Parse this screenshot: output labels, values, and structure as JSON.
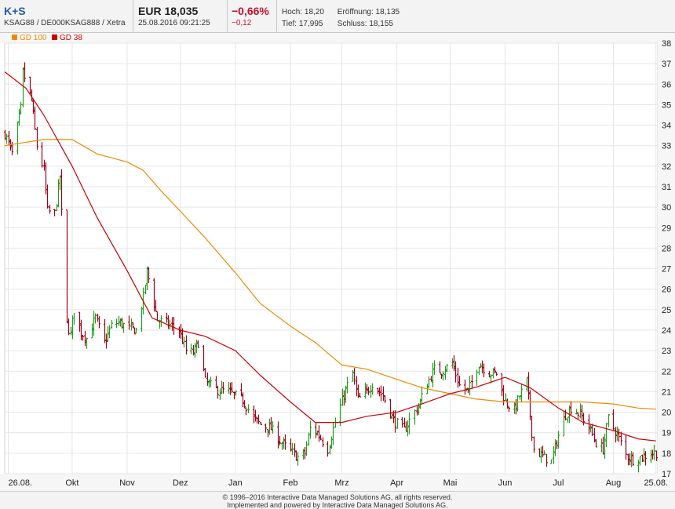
{
  "header": {
    "symbol": "K+S",
    "identifier": "KSAG88 / DE000KSAG888 / Xetra",
    "price": "EUR 18,035",
    "datetime": "25.08.2016 09:21:25",
    "change_pct": "−0,66%",
    "change_abs": "−0,12",
    "high_label": "Hoch:",
    "high_value": "18,20",
    "open_label": "Eröffnung:",
    "open_value": "18,135",
    "low_label": "Tief:",
    "low_value": "17,995",
    "close_label": "Schluss:",
    "close_value": "18,155"
  },
  "footer": {
    "line1": "© 1996–2016 Interactive Data Managed Solutions AG, all rights reserved.",
    "line2": "Implemented and powered by Interactive Data Managed Solutions AG."
  },
  "colors": {
    "gd100": "#ee8a00",
    "gd38": "#cc0000",
    "up": "#1f9e1f",
    "down": "#a0001a",
    "grid": "#e6e6e6"
  },
  "chart_data": {
    "type": "ohlc",
    "legend": [
      "GD 100",
      "GD 38"
    ],
    "legend_position": "top-left",
    "y_axis_position": "right",
    "ylim": [
      17,
      38
    ],
    "yticks": [
      17,
      18,
      19,
      20,
      21,
      22,
      23,
      24,
      25,
      26,
      27,
      28,
      29,
      30,
      31,
      32,
      33,
      34,
      35,
      36,
      37,
      38
    ],
    "xlim": [
      "2015-08-24",
      "2016-08-26"
    ],
    "x_ticks": [
      {
        "label": "26.08.",
        "date": "2015-08-26"
      },
      {
        "label": "Okt",
        "date": "2015-10-01"
      },
      {
        "label": "Nov",
        "date": "2015-11-01"
      },
      {
        "label": "Dez",
        "date": "2015-12-01"
      },
      {
        "label": "Jan",
        "date": "2016-01-01"
      },
      {
        "label": "Feb",
        "date": "2016-02-01"
      },
      {
        "label": "Mrz",
        "date": "2016-03-01"
      },
      {
        "label": "Apr",
        "date": "2016-04-01"
      },
      {
        "label": "Mai",
        "date": "2016-05-01"
      },
      {
        "label": "Jun",
        "date": "2016-06-01"
      },
      {
        "label": "Jul",
        "date": "2016-07-01"
      },
      {
        "label": "Aug",
        "date": "2016-08-01"
      },
      {
        "label": "25.08.",
        "date": "2016-08-25"
      }
    ],
    "grid": true,
    "price_path": [
      [
        "2015-08-24",
        33.6
      ],
      [
        "2015-08-28",
        32.6
      ],
      [
        "2015-09-02",
        34.8
      ],
      [
        "2015-09-03",
        36.6
      ],
      [
        "2015-09-08",
        35.2
      ],
      [
        "2015-09-11",
        33.0
      ],
      [
        "2015-09-15",
        31.8
      ],
      [
        "2015-09-17",
        29.8
      ],
      [
        "2015-09-21",
        29.7
      ],
      [
        "2015-09-24",
        31.5
      ],
      [
        "2015-09-28",
        24.3
      ],
      [
        "2015-09-30",
        23.8
      ],
      [
        "2015-10-02",
        25.0
      ],
      [
        "2015-10-06",
        23.9
      ],
      [
        "2015-10-09",
        23.6
      ],
      [
        "2015-10-14",
        24.6
      ],
      [
        "2015-10-19",
        23.4
      ],
      [
        "2015-10-23",
        24.2
      ],
      [
        "2015-10-27",
        24.4
      ],
      [
        "2015-11-02",
        24.1
      ],
      [
        "2015-11-06",
        24.0
      ],
      [
        "2015-11-10",
        25.6
      ],
      [
        "2015-11-12",
        26.9
      ],
      [
        "2015-11-16",
        25.3
      ],
      [
        "2015-11-18",
        24.5
      ],
      [
        "2015-11-24",
        24.3
      ],
      [
        "2015-11-30",
        24.0
      ],
      [
        "2015-12-04",
        23.0
      ],
      [
        "2015-12-08",
        22.9
      ],
      [
        "2015-12-11",
        23.4
      ],
      [
        "2015-12-15",
        21.5
      ],
      [
        "2015-12-21",
        21.1
      ],
      [
        "2015-12-28",
        21.0
      ],
      [
        "2016-01-05",
        20.6
      ],
      [
        "2016-01-11",
        19.7
      ],
      [
        "2016-01-15",
        19.4
      ],
      [
        "2016-01-21",
        19.2
      ],
      [
        "2016-01-27",
        18.5
      ],
      [
        "2016-02-01",
        18.1
      ],
      [
        "2016-02-05",
        17.8
      ],
      [
        "2016-02-09",
        18.0
      ],
      [
        "2016-02-12",
        19.2
      ],
      [
        "2016-02-16",
        19.0
      ],
      [
        "2016-02-22",
        18.2
      ],
      [
        "2016-02-26",
        19.5
      ],
      [
        "2016-03-03",
        21.1
      ],
      [
        "2016-03-07",
        21.9
      ],
      [
        "2016-03-10",
        20.6
      ],
      [
        "2016-03-15",
        21.0
      ],
      [
        "2016-03-18",
        21.4
      ],
      [
        "2016-03-24",
        20.8
      ],
      [
        "2016-03-30",
        19.6
      ],
      [
        "2016-04-05",
        19.1
      ],
      [
        "2016-04-08",
        19.6
      ],
      [
        "2016-04-13",
        20.3
      ],
      [
        "2016-04-18",
        21.4
      ],
      [
        "2016-04-22",
        22.1
      ],
      [
        "2016-04-26",
        22.0
      ],
      [
        "2016-05-02",
        22.4
      ],
      [
        "2016-05-06",
        21.3
      ],
      [
        "2016-05-11",
        21.0
      ],
      [
        "2016-05-17",
        22.4
      ],
      [
        "2016-05-23",
        21.9
      ],
      [
        "2016-05-27",
        21.9
      ],
      [
        "2016-06-01",
        20.5
      ],
      [
        "2016-06-06",
        20.1
      ],
      [
        "2016-06-09",
        20.8
      ],
      [
        "2016-06-13",
        21.5
      ],
      [
        "2016-06-17",
        18.2
      ],
      [
        "2016-06-21",
        17.9
      ],
      [
        "2016-06-27",
        17.6
      ],
      [
        "2016-06-30",
        18.6
      ],
      [
        "2016-07-05",
        19.9
      ],
      [
        "2016-07-08",
        20.2
      ],
      [
        "2016-07-13",
        19.9
      ],
      [
        "2016-07-18",
        19.3
      ],
      [
        "2016-07-22",
        18.5
      ],
      [
        "2016-07-26",
        18.2
      ],
      [
        "2016-07-29",
        19.7
      ],
      [
        "2016-08-03",
        18.9
      ],
      [
        "2016-08-08",
        17.9
      ],
      [
        "2016-08-12",
        17.7
      ],
      [
        "2016-08-17",
        17.8
      ],
      [
        "2016-08-22",
        18.0
      ],
      [
        "2016-08-25",
        18.03
      ]
    ],
    "series": [
      {
        "name": "GD 100",
        "points": [
          [
            "2015-08-24",
            33.0
          ],
          [
            "2015-09-15",
            33.3
          ],
          [
            "2015-10-01",
            33.3
          ],
          [
            "2015-10-15",
            32.6
          ],
          [
            "2015-11-01",
            32.2
          ],
          [
            "2015-11-10",
            31.8
          ],
          [
            "2015-11-20",
            30.8
          ],
          [
            "2015-12-01",
            29.8
          ],
          [
            "2015-12-15",
            28.5
          ],
          [
            "2016-01-01",
            26.8
          ],
          [
            "2016-01-15",
            25.3
          ],
          [
            "2016-02-01",
            24.2
          ],
          [
            "2016-02-15",
            23.4
          ],
          [
            "2016-03-01",
            22.3
          ],
          [
            "2016-03-15",
            22.1
          ],
          [
            "2016-04-01",
            21.6
          ],
          [
            "2016-04-15",
            21.2
          ],
          [
            "2016-05-01",
            20.9
          ],
          [
            "2016-05-15",
            20.65
          ],
          [
            "2016-06-01",
            20.5
          ],
          [
            "2016-06-15",
            20.5
          ],
          [
            "2016-07-01",
            20.5
          ],
          [
            "2016-07-15",
            20.5
          ],
          [
            "2016-08-01",
            20.4
          ],
          [
            "2016-08-15",
            20.2
          ],
          [
            "2016-08-25",
            20.15
          ]
        ]
      },
      {
        "name": "GD 38",
        "points": [
          [
            "2015-08-24",
            36.6
          ],
          [
            "2015-09-05",
            35.8
          ],
          [
            "2015-09-15",
            34.5
          ],
          [
            "2015-10-01",
            32.0
          ],
          [
            "2015-10-15",
            29.5
          ],
          [
            "2015-11-01",
            26.9
          ],
          [
            "2015-11-15",
            24.6
          ],
          [
            "2015-12-01",
            24.0
          ],
          [
            "2015-12-15",
            23.7
          ],
          [
            "2016-01-01",
            23.0
          ],
          [
            "2016-01-15",
            21.8
          ],
          [
            "2016-02-01",
            20.5
          ],
          [
            "2016-02-15",
            19.5
          ],
          [
            "2016-03-01",
            19.5
          ],
          [
            "2016-03-15",
            19.8
          ],
          [
            "2016-04-01",
            20.0
          ],
          [
            "2016-04-15",
            20.4
          ],
          [
            "2016-05-01",
            20.9
          ],
          [
            "2016-05-15",
            21.2
          ],
          [
            "2016-06-01",
            21.7
          ],
          [
            "2016-06-15",
            21.2
          ],
          [
            "2016-07-01",
            20.2
          ],
          [
            "2016-07-15",
            19.5
          ],
          [
            "2016-08-01",
            19.1
          ],
          [
            "2016-08-15",
            18.7
          ],
          [
            "2016-08-25",
            18.6
          ]
        ]
      }
    ]
  }
}
